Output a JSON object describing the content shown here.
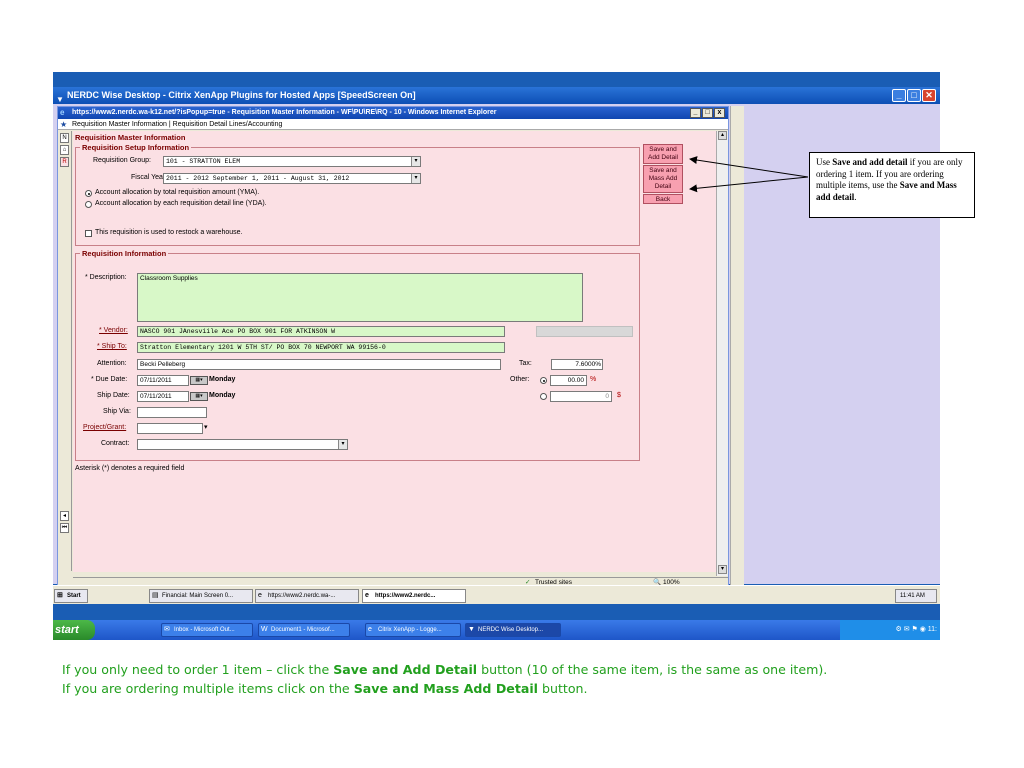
{
  "citrix": {
    "title": "NERDC Wise Desktop - Citrix XenApp Plugins for Hosted Apps [SpeedScreen On]"
  },
  "ie": {
    "title": "https://www2.nerdc.wa-k12.net/?isPopup=true - Requisition Master Information - WF\\PU\\RE\\RQ - 10 - Windows Internet Explorer",
    "breadcrumb": "Requisition Master Information | Requisition Detail Lines/Accounting",
    "page_title": "Requisition Master Information",
    "status_trusted": "Trusted sites",
    "zoom": "100%"
  },
  "setup": {
    "legend": "Requisition Setup Information",
    "group_label": "Requisition Group:",
    "group_value": "101 - STRATTON ELEM",
    "fiscal_label": "Fiscal Year:",
    "fiscal_value": "2011 - 2012 September 1, 2011 - August 31, 2012",
    "radio_yma": "Account allocation by total requisition amount (YMA).",
    "radio_yda": "Account allocation by each requisition detail line (YDA).",
    "restock": "This requisition is used to restock a warehouse."
  },
  "buttons": {
    "save_add_1": "Save and",
    "save_add_2": "Add Detail",
    "save_mass_1": "Save and",
    "save_mass_2": "Mass Add",
    "save_mass_3": "Detail",
    "back": "Back"
  },
  "info": {
    "legend": "Requisition Information",
    "description_label": "* Description:",
    "description_value": "Classroom Supplies",
    "vendor_label": "* Vendor:",
    "vendor_value": "NASCO                           901 JAnesviile Ace PO BOX 901 FOR ATKINSON W",
    "shipto_label": "* Ship To:",
    "shipto_value": "Stratton Elementary              1201 W 5TH ST/ PO BOX 70 NEWPORT WA 99156-0",
    "attention_label": "Attention:",
    "attention_value": "Becki Pelleberg",
    "tax_label": "Tax:",
    "tax_value": "7.6000",
    "tax_unit": "%",
    "due_label": "* Due Date:",
    "due_value": "07/11/2011",
    "due_day": "Monday",
    "ship_label": "Ship Date:",
    "ship_value": "07/11/2011",
    "ship_day": "Monday",
    "other_label": "Other:",
    "other_pct": "00.00",
    "other_pct_unit": "%",
    "other_amt": "0",
    "other_amt_unit": "$",
    "shipvia_label": "Ship Via:",
    "project_label": "Project/Grant:",
    "contract_label": "Contract:"
  },
  "footnote": "Asterisk (*) denotes a required field",
  "callout": {
    "t1": "Use ",
    "b1": "Save and add detail",
    "t2": " if you are only ordering 1 item.  If you are ordering multiple items, use the ",
    "b2": "Save and Mass add detail",
    "t3": "."
  },
  "citrix_taskbar": {
    "start": "Start",
    "items": [
      "Financial: Main Screen 0...",
      "https://www2.nerdc.wa-...",
      "https://www2.nerdc..."
    ],
    "clock": "11:41 AM"
  },
  "xp_taskbar": {
    "start": "start",
    "items": [
      "Inbox - Microsoft Out...",
      "Document1 - Microsof...",
      "Citrix XenApp - Logge...",
      "NERDC Wise Desktop..."
    ],
    "clock": "11:"
  },
  "caption": {
    "line1_a": "If you only need to order 1 item – click the ",
    "line1_b": "Save and Add Detail",
    "line1_c": " button (10 of the same item, is the same as one item).",
    "line2_a": "If you are ordering multiple items click on the ",
    "line2_b": "Save and Mass Add Detail",
    "line2_c": " button."
  },
  "colors": {
    "accent_pink": "#f8a0b0",
    "form_bg": "#fbe0e4",
    "caption_green": "#22a01e"
  }
}
